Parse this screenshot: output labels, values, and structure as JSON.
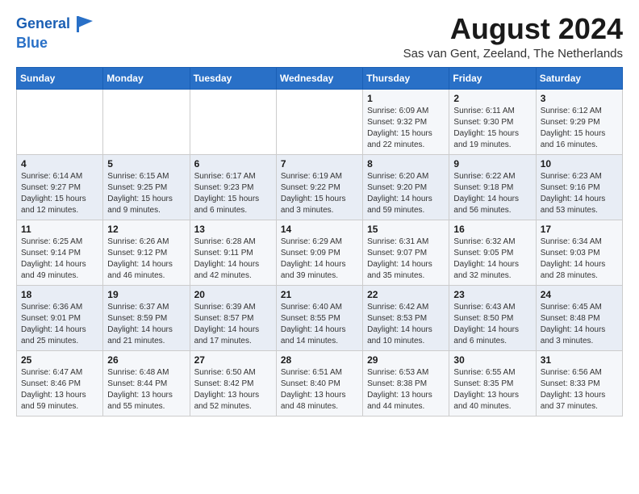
{
  "header": {
    "logo_line1": "General",
    "logo_line2": "Blue",
    "month": "August 2024",
    "location": "Sas van Gent, Zeeland, The Netherlands"
  },
  "weekdays": [
    "Sunday",
    "Monday",
    "Tuesday",
    "Wednesday",
    "Thursday",
    "Friday",
    "Saturday"
  ],
  "weeks": [
    [
      {
        "day": "",
        "info": ""
      },
      {
        "day": "",
        "info": ""
      },
      {
        "day": "",
        "info": ""
      },
      {
        "day": "",
        "info": ""
      },
      {
        "day": "1",
        "info": "Sunrise: 6:09 AM\nSunset: 9:32 PM\nDaylight: 15 hours\nand 22 minutes."
      },
      {
        "day": "2",
        "info": "Sunrise: 6:11 AM\nSunset: 9:30 PM\nDaylight: 15 hours\nand 19 minutes."
      },
      {
        "day": "3",
        "info": "Sunrise: 6:12 AM\nSunset: 9:29 PM\nDaylight: 15 hours\nand 16 minutes."
      }
    ],
    [
      {
        "day": "4",
        "info": "Sunrise: 6:14 AM\nSunset: 9:27 PM\nDaylight: 15 hours\nand 12 minutes."
      },
      {
        "day": "5",
        "info": "Sunrise: 6:15 AM\nSunset: 9:25 PM\nDaylight: 15 hours\nand 9 minutes."
      },
      {
        "day": "6",
        "info": "Sunrise: 6:17 AM\nSunset: 9:23 PM\nDaylight: 15 hours\nand 6 minutes."
      },
      {
        "day": "7",
        "info": "Sunrise: 6:19 AM\nSunset: 9:22 PM\nDaylight: 15 hours\nand 3 minutes."
      },
      {
        "day": "8",
        "info": "Sunrise: 6:20 AM\nSunset: 9:20 PM\nDaylight: 14 hours\nand 59 minutes."
      },
      {
        "day": "9",
        "info": "Sunrise: 6:22 AM\nSunset: 9:18 PM\nDaylight: 14 hours\nand 56 minutes."
      },
      {
        "day": "10",
        "info": "Sunrise: 6:23 AM\nSunset: 9:16 PM\nDaylight: 14 hours\nand 53 minutes."
      }
    ],
    [
      {
        "day": "11",
        "info": "Sunrise: 6:25 AM\nSunset: 9:14 PM\nDaylight: 14 hours\nand 49 minutes."
      },
      {
        "day": "12",
        "info": "Sunrise: 6:26 AM\nSunset: 9:12 PM\nDaylight: 14 hours\nand 46 minutes."
      },
      {
        "day": "13",
        "info": "Sunrise: 6:28 AM\nSunset: 9:11 PM\nDaylight: 14 hours\nand 42 minutes."
      },
      {
        "day": "14",
        "info": "Sunrise: 6:29 AM\nSunset: 9:09 PM\nDaylight: 14 hours\nand 39 minutes."
      },
      {
        "day": "15",
        "info": "Sunrise: 6:31 AM\nSunset: 9:07 PM\nDaylight: 14 hours\nand 35 minutes."
      },
      {
        "day": "16",
        "info": "Sunrise: 6:32 AM\nSunset: 9:05 PM\nDaylight: 14 hours\nand 32 minutes."
      },
      {
        "day": "17",
        "info": "Sunrise: 6:34 AM\nSunset: 9:03 PM\nDaylight: 14 hours\nand 28 minutes."
      }
    ],
    [
      {
        "day": "18",
        "info": "Sunrise: 6:36 AM\nSunset: 9:01 PM\nDaylight: 14 hours\nand 25 minutes."
      },
      {
        "day": "19",
        "info": "Sunrise: 6:37 AM\nSunset: 8:59 PM\nDaylight: 14 hours\nand 21 minutes."
      },
      {
        "day": "20",
        "info": "Sunrise: 6:39 AM\nSunset: 8:57 PM\nDaylight: 14 hours\nand 17 minutes."
      },
      {
        "day": "21",
        "info": "Sunrise: 6:40 AM\nSunset: 8:55 PM\nDaylight: 14 hours\nand 14 minutes."
      },
      {
        "day": "22",
        "info": "Sunrise: 6:42 AM\nSunset: 8:53 PM\nDaylight: 14 hours\nand 10 minutes."
      },
      {
        "day": "23",
        "info": "Sunrise: 6:43 AM\nSunset: 8:50 PM\nDaylight: 14 hours\nand 6 minutes."
      },
      {
        "day": "24",
        "info": "Sunrise: 6:45 AM\nSunset: 8:48 PM\nDaylight: 14 hours\nand 3 minutes."
      }
    ],
    [
      {
        "day": "25",
        "info": "Sunrise: 6:47 AM\nSunset: 8:46 PM\nDaylight: 13 hours\nand 59 minutes."
      },
      {
        "day": "26",
        "info": "Sunrise: 6:48 AM\nSunset: 8:44 PM\nDaylight: 13 hours\nand 55 minutes."
      },
      {
        "day": "27",
        "info": "Sunrise: 6:50 AM\nSunset: 8:42 PM\nDaylight: 13 hours\nand 52 minutes."
      },
      {
        "day": "28",
        "info": "Sunrise: 6:51 AM\nSunset: 8:40 PM\nDaylight: 13 hours\nand 48 minutes."
      },
      {
        "day": "29",
        "info": "Sunrise: 6:53 AM\nSunset: 8:38 PM\nDaylight: 13 hours\nand 44 minutes."
      },
      {
        "day": "30",
        "info": "Sunrise: 6:55 AM\nSunset: 8:35 PM\nDaylight: 13 hours\nand 40 minutes."
      },
      {
        "day": "31",
        "info": "Sunrise: 6:56 AM\nSunset: 8:33 PM\nDaylight: 13 hours\nand 37 minutes."
      }
    ]
  ]
}
